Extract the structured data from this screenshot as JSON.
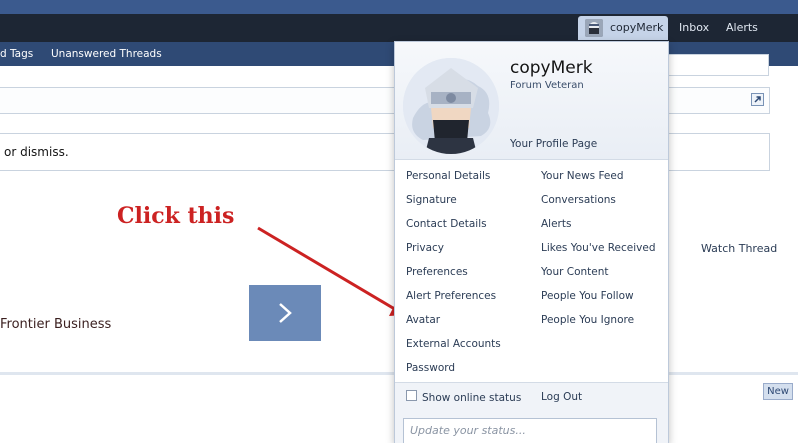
{
  "header": {
    "username": "copyMerk",
    "inbox_label": "Inbox",
    "alerts_label": "Alerts"
  },
  "nav": {
    "tags_label": "d Tags",
    "unanswered_label": "Unanswered Threads"
  },
  "page": {
    "notice_text": "or dismiss.",
    "watch_thread": "Watch Thread",
    "business_text": "Frontier Business",
    "new_button": "New"
  },
  "annotation": {
    "text": "Click this",
    "color": "#cc2222"
  },
  "menu": {
    "username": "copyMerk",
    "user_title": "Forum Veteran",
    "profile_link": "Your Profile Page",
    "left_items": [
      "Personal Details",
      "Signature",
      "Contact Details",
      "Privacy",
      "Preferences",
      "Alert Preferences",
      "Avatar",
      "External Accounts",
      "Password"
    ],
    "right_items": [
      "Your News Feed",
      "Conversations",
      "Alerts",
      "Likes You've Received",
      "Your Content",
      "People You Follow",
      "People You Ignore"
    ],
    "show_online_status": "Show online status",
    "log_out": "Log Out",
    "status_placeholder": "Update your status..."
  },
  "icons": [
    "expand-icon",
    "chevron-right-icon",
    "avatar-image",
    "checkbox"
  ],
  "colors": {
    "accent": "#2f4a75",
    "header_dark": "#1d2634",
    "header_top": "#3b5a8e"
  }
}
